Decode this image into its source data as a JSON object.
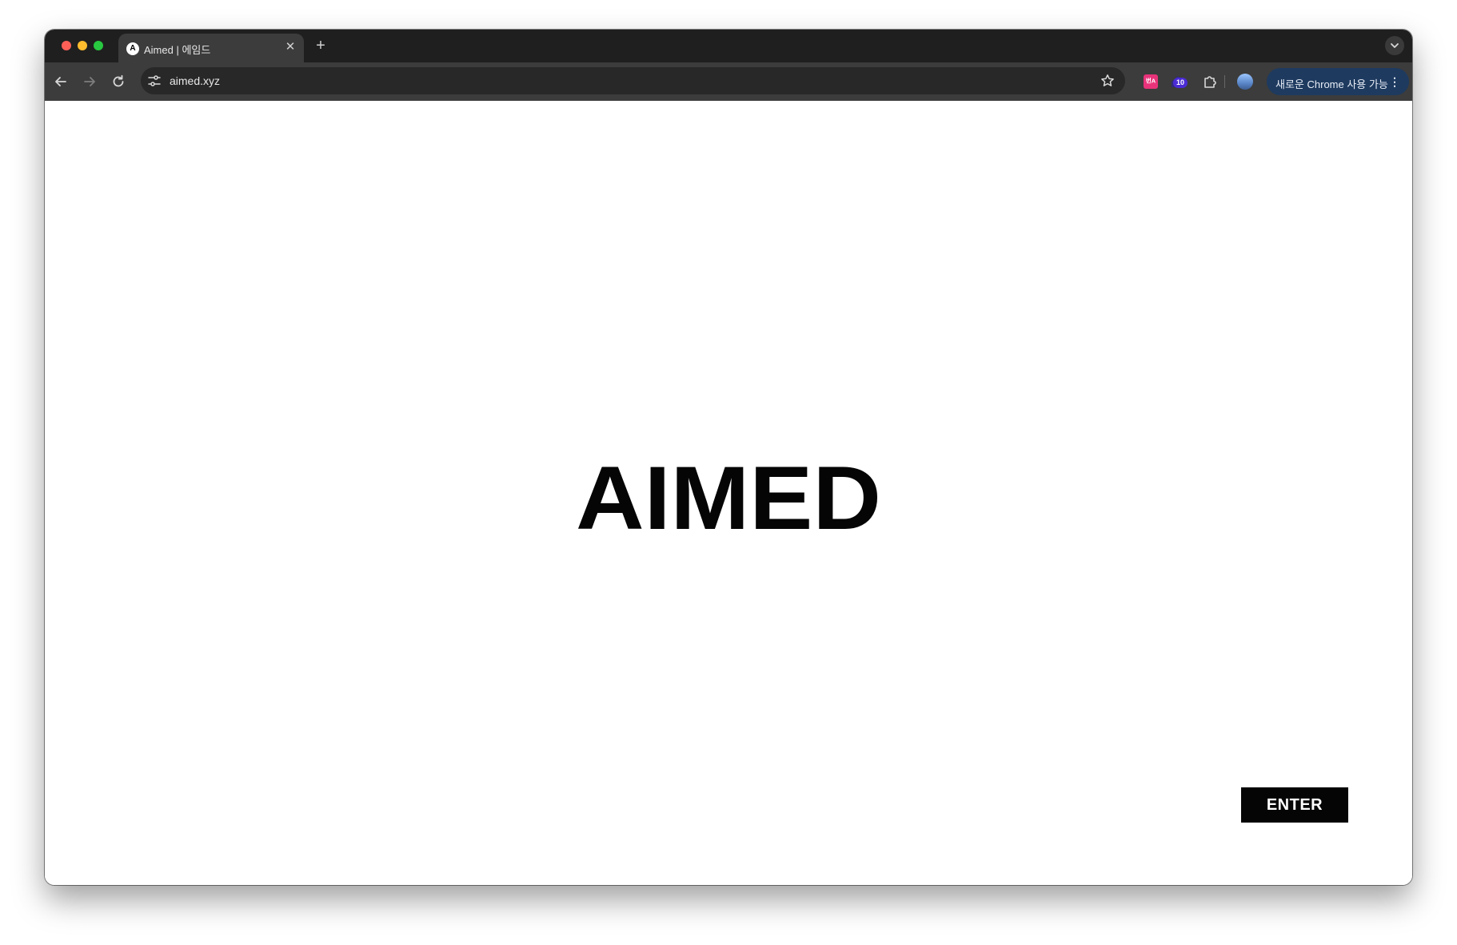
{
  "browser": {
    "tab": {
      "favicon_letter": "A",
      "title": "Aimed | 에임드",
      "close_glyph": "✕"
    },
    "new_tab_glyph": "+",
    "address_bar": {
      "url": "aimed.xyz"
    },
    "extensions": {
      "translate_label": "번A",
      "badge_count": "10"
    },
    "update_button": {
      "label": "새로운 Chrome 사용 가능",
      "menu_glyph": "⋮"
    },
    "icons": [
      "back-arrow-icon",
      "forward-arrow-icon",
      "reload-icon",
      "site-settings-icon",
      "bookmark-star-icon",
      "extensions-puzzle-icon",
      "tab-search-chevron-icon"
    ]
  },
  "page": {
    "logo_text": "AIMED",
    "enter_label": "ENTER"
  },
  "colors": {
    "tab_strip": "#1f1f1f",
    "toolbar": "#3c3c3c",
    "omnibox": "#282828",
    "update_pill": "#1e3a5f",
    "page_background": "#ffffff",
    "logo": "#050505",
    "enter_button": "#050505"
  }
}
